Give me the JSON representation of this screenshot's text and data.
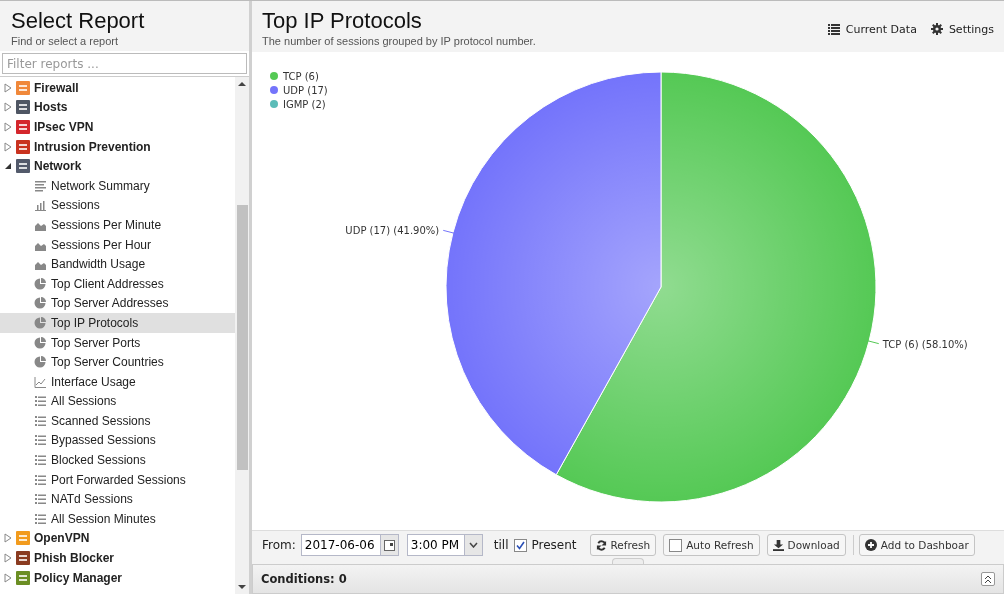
{
  "sidebar": {
    "title": "Select Report",
    "subtitle": "Find or select a report",
    "filter": {
      "placeholder": "Filter reports ..."
    },
    "tree": [
      {
        "label": "Firewall",
        "color": "#f0883a",
        "expanded": false
      },
      {
        "label": "Hosts",
        "color": "#4f5663",
        "expanded": false
      },
      {
        "label": "IPsec VPN",
        "color": "#d4262c",
        "expanded": false
      },
      {
        "label": "Intrusion Prevention",
        "color": "#c9321f",
        "expanded": false
      },
      {
        "label": "Network",
        "color": "#535a6b",
        "expanded": true,
        "children": [
          {
            "label": "Network Summary",
            "kind": "text",
            "selected": false
          },
          {
            "label": "Sessions",
            "kind": "bar",
            "selected": false
          },
          {
            "label": "Sessions Per Minute",
            "kind": "area",
            "selected": false
          },
          {
            "label": "Sessions Per Hour",
            "kind": "area",
            "selected": false
          },
          {
            "label": "Bandwidth Usage",
            "kind": "area",
            "selected": false
          },
          {
            "label": "Top Client Addresses",
            "kind": "pie",
            "selected": false
          },
          {
            "label": "Top Server Addresses",
            "kind": "pie",
            "selected": false
          },
          {
            "label": "Top IP Protocols",
            "kind": "pie",
            "selected": true
          },
          {
            "label": "Top Server Ports",
            "kind": "pie",
            "selected": false
          },
          {
            "label": "Top Server Countries",
            "kind": "pie",
            "selected": false
          },
          {
            "label": "Interface Usage",
            "kind": "line",
            "selected": false
          },
          {
            "label": "All Sessions",
            "kind": "list",
            "selected": false
          },
          {
            "label": "Scanned Sessions",
            "kind": "list",
            "selected": false
          },
          {
            "label": "Bypassed Sessions",
            "kind": "list",
            "selected": false
          },
          {
            "label": "Blocked Sessions",
            "kind": "list",
            "selected": false
          },
          {
            "label": "Port Forwarded Sessions",
            "kind": "list",
            "selected": false
          },
          {
            "label": "NATd Sessions",
            "kind": "list",
            "selected": false
          },
          {
            "label": "All Session Minutes",
            "kind": "list",
            "selected": false
          }
        ]
      },
      {
        "label": "OpenVPN",
        "color": "#f29b1d",
        "expanded": false
      },
      {
        "label": "Phish Blocker",
        "color": "#8a3b20",
        "expanded": false
      },
      {
        "label": "Policy Manager",
        "color": "#6b8e23",
        "expanded": false
      }
    ]
  },
  "report": {
    "title": "Top IP Protocols",
    "description": "The number of sessions grouped by IP protocol number.",
    "actions": [
      {
        "label": "Current Data",
        "kind": "list"
      },
      {
        "label": "Settings",
        "kind": "gear"
      }
    ],
    "chart_data": {
      "type": "pie",
      "categories": [
        "TCP (6)",
        "UDP (17)",
        "IGMP (2)"
      ],
      "values": [
        58.1,
        41.9,
        0
      ],
      "colors": [
        "#55c955",
        "#7474fb",
        "#5bbcb8"
      ],
      "value_labels": [
        "TCP (6) (58.10%)",
        "UDP (17) (41.90%)",
        null
      ],
      "legend": "top-left"
    }
  },
  "toolbar": {
    "from_label": "From:",
    "date": "2017-06-06",
    "time": "3:00 PM",
    "till_label": "till",
    "present": {
      "label": "Present",
      "checked": true
    },
    "buttons": [
      {
        "label": "Refresh",
        "kind": "refresh"
      },
      {
        "label": "Auto Refresh",
        "kind": "check",
        "checked": false
      },
      {
        "label": "Download",
        "kind": "download"
      },
      {
        "label": "Add to Dashboar",
        "kind": "add"
      }
    ]
  },
  "conditions": {
    "label": "Conditions: 0"
  }
}
